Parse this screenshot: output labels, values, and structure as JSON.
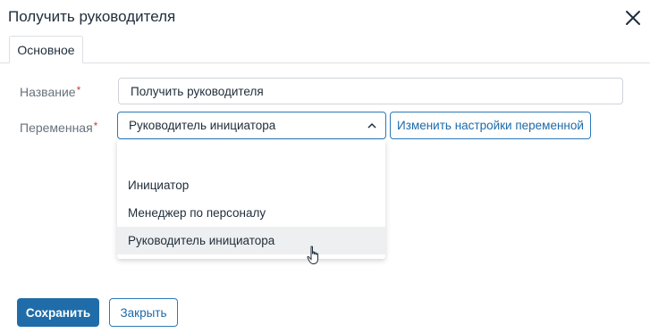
{
  "dialog": {
    "title": "Получить руководителя"
  },
  "tabs": [
    {
      "label": "Основное",
      "active": true
    }
  ],
  "form": {
    "name_label": "Название",
    "name_value": "Получить руководителя",
    "variable_label": "Переменная",
    "required_mark": "*",
    "variable_value": "Руководитель инициатора",
    "change_settings_label": "Изменить настройки переменной"
  },
  "dropdown": {
    "options": [
      {
        "label": ""
      },
      {
        "label": "Инициатор"
      },
      {
        "label": "Менеджер по персоналу"
      },
      {
        "label": "Руководитель инициатора",
        "hovered": true
      }
    ]
  },
  "footer": {
    "save_label": "Сохранить",
    "close_label": "Закрыть"
  },
  "colors": {
    "primary": "#1f6ca8",
    "required": "#d23c3c",
    "hover_bg": "#eeeff1"
  },
  "icons": {
    "close": "close-icon",
    "chevron": "chevron-up-icon",
    "cursor": "hand-pointer-icon"
  }
}
